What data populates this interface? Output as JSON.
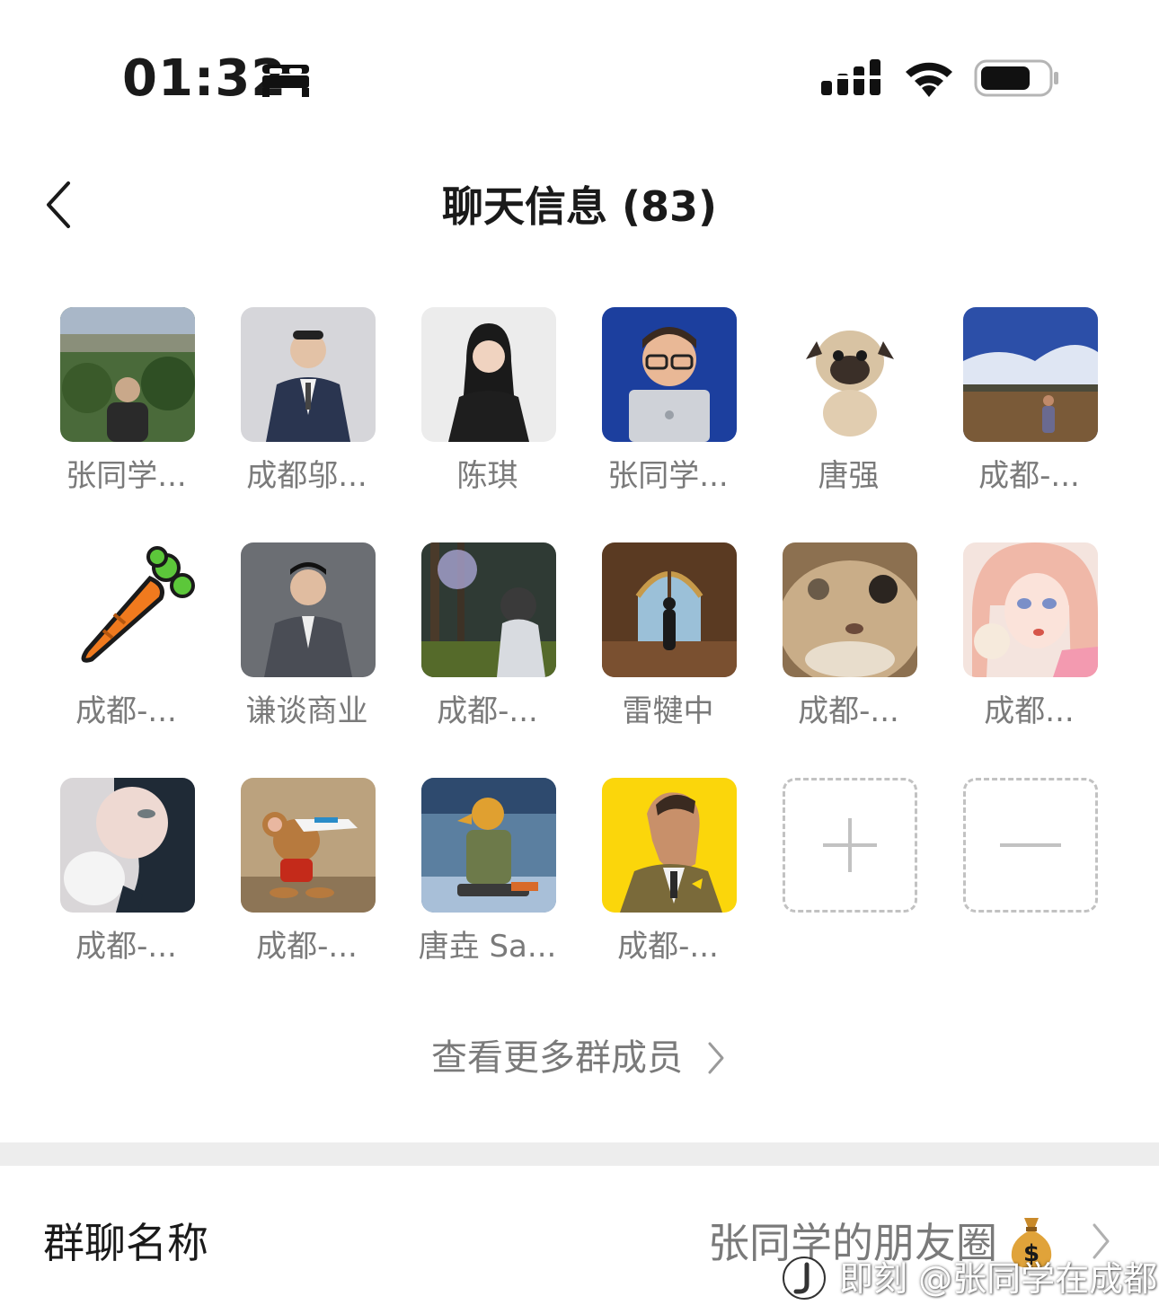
{
  "status_bar": {
    "time": "01:32"
  },
  "header": {
    "title": "聊天信息 (83)"
  },
  "members": [
    {
      "name": "张同学..."
    },
    {
      "name": "成都邬..."
    },
    {
      "name": "陈琪"
    },
    {
      "name": "张同学..."
    },
    {
      "name": "唐强"
    },
    {
      "name": "成都-..."
    },
    {
      "name": "成都-..."
    },
    {
      "name": "谦谈商业"
    },
    {
      "name": "成都-..."
    },
    {
      "name": "雷犍中"
    },
    {
      "name": "成都-..."
    },
    {
      "name": "成都..."
    },
    {
      "name": "成都-..."
    },
    {
      "name": "成都-..."
    },
    {
      "name": "唐垚 Sa..."
    },
    {
      "name": "成都-..."
    }
  ],
  "more_members": {
    "label": "查看更多群成员"
  },
  "group_name_row": {
    "label": "群聊名称",
    "value": "张同学的朋友圈"
  },
  "watermark": {
    "text": "即刻 @张同学在成都"
  },
  "colors": {
    "secondary_text": "#7a7a7a",
    "divider": "#ededed",
    "dashed_border": "#c2c2c2"
  }
}
